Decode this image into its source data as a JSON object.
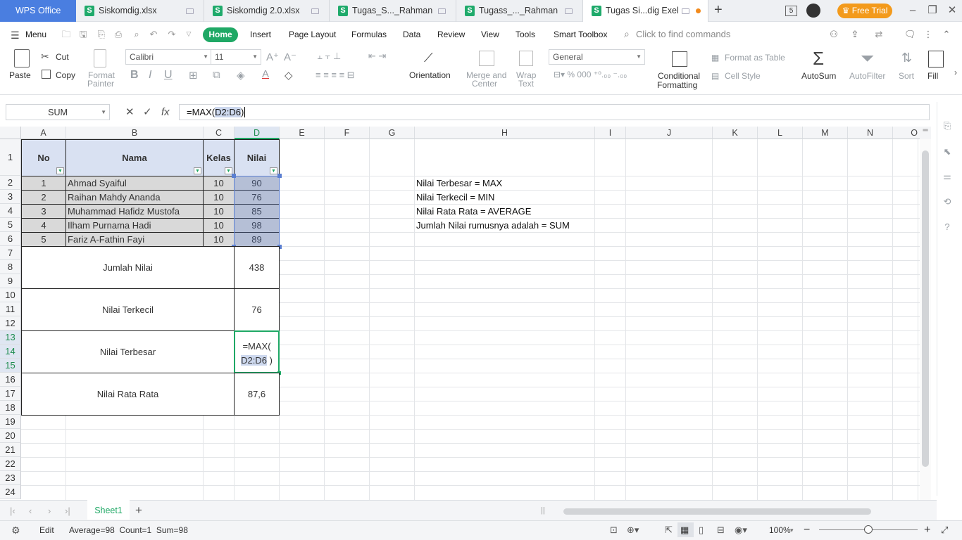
{
  "titlebar": {
    "app_tab": "WPS Office",
    "tabs": [
      "Siskomdig.xlsx",
      "Siskomdig 2.0.xlsx",
      "Tugas_S..._Rahman",
      "Tugass_..._Rahman",
      "Tugas Si...dig Exel"
    ],
    "new_tab": "+",
    "page_count": "5",
    "free_trial": "Free Trial",
    "minimize": "–",
    "restore": "❐",
    "close": "✕"
  },
  "menubar": {
    "menu": "Menu",
    "items": [
      "Home",
      "Insert",
      "Page Layout",
      "Formulas",
      "Data",
      "Review",
      "View",
      "Tools",
      "Smart Toolbox"
    ],
    "search_placeholder": "Click to find commands"
  },
  "ribbon": {
    "paste": "Paste",
    "cut": "Cut",
    "copy": "Copy",
    "format_painter_1": "Format",
    "format_painter_2": "Painter",
    "font_name": "Calibri",
    "font_size": "11",
    "orientation": "Orientation",
    "merge_1": "Merge and",
    "merge_2": "Center",
    "wrap_1": "Wrap",
    "wrap_2": "Text",
    "number_format": "General",
    "cond_fmt_1": "Conditional",
    "cond_fmt_2": "Formatting",
    "format_as_table": "Format as Table",
    "cell_style": "Cell Style",
    "autosum": "AutoSum",
    "autofilter": "AutoFilter",
    "sort": "Sort",
    "fill": "Fill"
  },
  "formulabar": {
    "name_box": "SUM",
    "cancel": "✕",
    "confirm": "✓",
    "fx": "fx",
    "formula_pre": "=MAX(",
    "formula_ref": "D2:D6",
    "formula_post": ")"
  },
  "columns": [
    "A",
    "B",
    "C",
    "D",
    "E",
    "F",
    "G",
    "H",
    "I",
    "J",
    "K",
    "L",
    "M",
    "N",
    "O"
  ],
  "rows": [
    "1",
    "2",
    "3",
    "4",
    "5",
    "6",
    "7",
    "8",
    "9",
    "10",
    "11",
    "12",
    "13",
    "14",
    "15",
    "16",
    "17",
    "18",
    "19",
    "20",
    "21",
    "22",
    "23",
    "24"
  ],
  "table": {
    "headers": [
      "No",
      "Nama",
      "Kelas",
      "Nilai"
    ],
    "rows": [
      [
        "1",
        "Ahmad Syaiful",
        "10",
        "90"
      ],
      [
        "2",
        "Raihan Mahdy Ananda",
        "10",
        "76"
      ],
      [
        "3",
        "Muhammad Hafidz Mustofa",
        "10",
        "85"
      ],
      [
        "4",
        "Ilham Purnama Hadi",
        "10",
        "98"
      ],
      [
        "5",
        "Fariz A-Fathin Fayi",
        "10",
        "89"
      ]
    ]
  },
  "summary": {
    "jumlah_label": "Jumlah Nilai",
    "jumlah_value": "438",
    "terkecil_label": "Nilai  Terkecil",
    "terkecil_value": "76",
    "terbesar_label": "Nilai Terbesar",
    "terbesar_edit_1": "=MAX(",
    "terbesar_edit_ref": "D2:D6",
    "terbesar_edit_post": ")",
    "rata_label": "Nilai Rata Rata",
    "rata_value": "87,6"
  },
  "notes": [
    "Nilai Terbesar = MAX",
    "Nilai Terkecil = MIN",
    "Nilai Rata Rata = AVERAGE",
    "Jumlah Nilai rumusnya adalah = SUM"
  ],
  "sheets": {
    "active": "Sheet1",
    "add": "+"
  },
  "statusbar": {
    "mode": "Edit",
    "stats": "Average=98  Count=1  Sum=98",
    "zoom": "100%",
    "zoom_fraction": 0.5
  },
  "colors": {
    "accent": "#1fa865",
    "header_fill": "#d9e1f2",
    "data_fill": "#d9d9d9",
    "wps_blue": "#4a7ee0",
    "trial_orange": "#f39a1b"
  }
}
